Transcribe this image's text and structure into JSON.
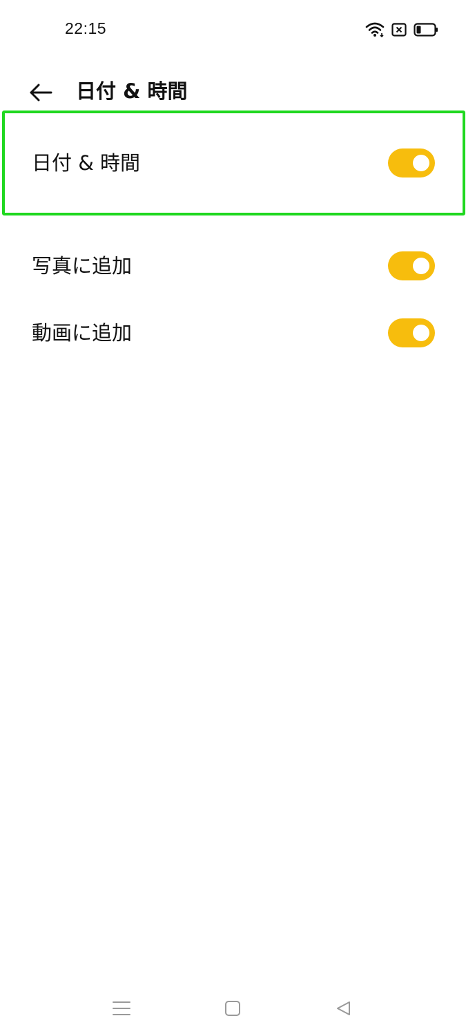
{
  "status_bar": {
    "time": "22:15",
    "icons": [
      "wifi-icon",
      "sim-off-icon",
      "battery-icon"
    ]
  },
  "header": {
    "back_icon": "arrow-left-icon",
    "title": "日付 & 時間"
  },
  "settings": [
    {
      "label": "日付 & 時間",
      "enabled": true,
      "highlighted": true
    },
    {
      "label": "写真に追加",
      "enabled": true,
      "highlighted": false
    },
    {
      "label": "動画に追加",
      "enabled": true,
      "highlighted": false
    }
  ],
  "colors": {
    "toggle_on": "#f7bd0d",
    "highlight_border": "#1fd81f",
    "nav_icons": "#9a9a9a"
  },
  "nav_bar": {
    "icons": [
      "menu-icon",
      "home-icon",
      "back-triangle-icon"
    ]
  }
}
